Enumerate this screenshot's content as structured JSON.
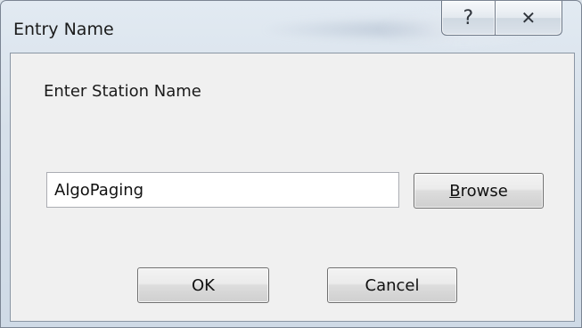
{
  "window": {
    "title": "Entry Name"
  },
  "caption": {
    "help_icon": "?",
    "close_icon": "✕"
  },
  "dialog": {
    "prompt": "Enter Station Name",
    "station_input": {
      "value": "AlgoPaging",
      "placeholder": ""
    },
    "browse": {
      "accel": "B",
      "rest": "rowse"
    },
    "ok_label": "OK",
    "cancel_label": "Cancel"
  }
}
